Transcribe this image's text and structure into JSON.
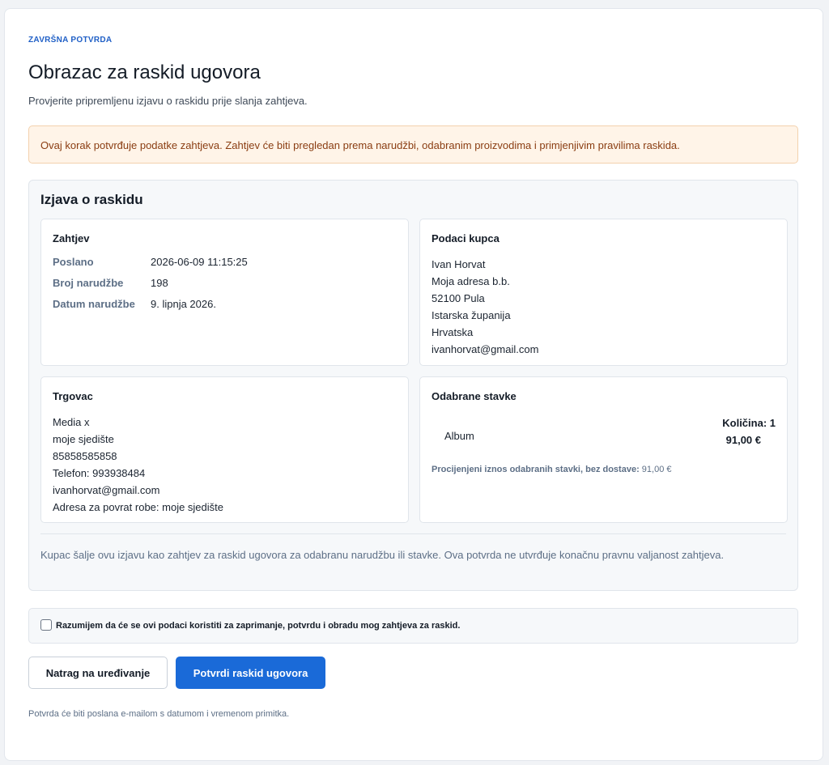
{
  "header": {
    "eyebrow": "ZAVRŠNA POTVRDA",
    "title": "Obrazac za raskid ugovora",
    "subtitle": "Provjerite pripremljenu izjavu o raskidu prije slanja zahtjeva."
  },
  "notice": "Ovaj korak potvrđuje podatke zahtjeva. Zahtjev će biti pregledan prema narudžbi, odabranim proizvodima i primjenjivim pravilima raskida.",
  "statement": {
    "title": "Izjava o raskidu",
    "request": {
      "heading": "Zahtjev",
      "rows": [
        {
          "label": "Poslano",
          "value": "2026-06-09 11:15:25"
        },
        {
          "label": "Broj narudžbe",
          "value": "198"
        },
        {
          "label": "Datum narudžbe",
          "value": "9. lipnja 2026."
        }
      ]
    },
    "customer": {
      "heading": "Podaci kupca",
      "lines": [
        "Ivan Horvat",
        "Moja adresa b.b.",
        "52100 Pula",
        "Istarska županija",
        "Hrvatska",
        "ivanhorvat@gmail.com"
      ]
    },
    "merchant": {
      "heading": "Trgovac",
      "lines": [
        "Media x",
        "moje sjedište",
        "85858585858",
        "Telefon: 993938484",
        "ivanhorvat@gmail.com",
        "Adresa za povrat robe: moje sjedište"
      ]
    },
    "items": {
      "heading": "Odabrane stavke",
      "list": [
        {
          "name": "Album",
          "quantity": "Količina: 1",
          "price": "91,00 €"
        }
      ],
      "estimate_label": "Procijenjeni iznos odabranih stavki, bez dostave:",
      "estimate_value": "91,00 €"
    },
    "disclaimer": "Kupac šalje ovu izjavu kao zahtjev za raskid ugovora za odabranu narudžbu ili stavke. Ova potvrda ne utvrđuje konačnu pravnu valjanost zahtjeva."
  },
  "consent": {
    "checked": false,
    "label": "Razumijem da će se ovi podaci koristiti za zaprimanje, potvrdu i obradu mog zahtjeva za raskid."
  },
  "actions": {
    "back_label": "Natrag na uređivanje",
    "confirm_label": "Potvrdi raskid ugovora"
  },
  "footnote": "Potvrda će biti poslana e-mailom s datumom i vremenom primitka.",
  "colors": {
    "accent": "#1a6ad8",
    "notice_bg": "#fff4e8",
    "notice_text": "#8a3d12"
  }
}
